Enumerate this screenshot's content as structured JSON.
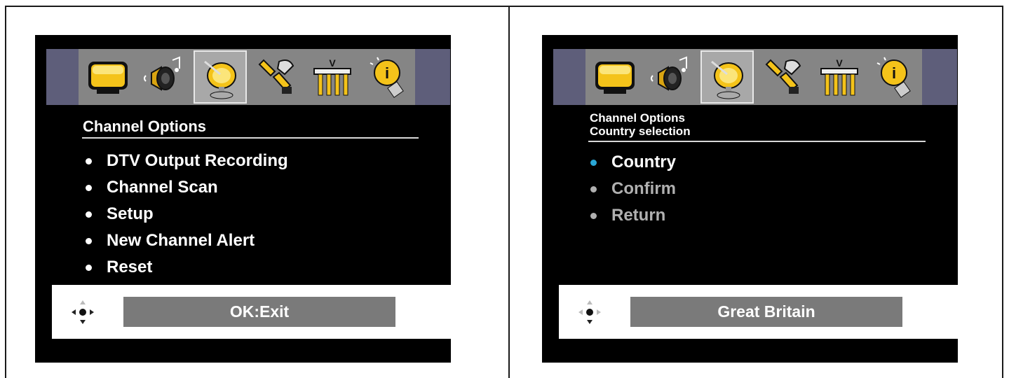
{
  "icons": [
    "picture-icon",
    "audio-icon",
    "channel-satellite-icon",
    "tools-icon",
    "parental-lock-icon",
    "info-icon"
  ],
  "left": {
    "title": "Channel Options",
    "items": [
      {
        "label": "DTV Output Recording"
      },
      {
        "label": "Channel Scan"
      },
      {
        "label": "Setup"
      },
      {
        "label": "New Channel Alert"
      },
      {
        "label": "Reset"
      }
    ],
    "status": "OK:Exit"
  },
  "right": {
    "title": "Channel Options",
    "subtitle": "Country selection",
    "items": [
      {
        "label": "Country",
        "state": "active"
      },
      {
        "label": "Confirm",
        "state": "disabled"
      },
      {
        "label": "Return",
        "state": "disabled"
      }
    ],
    "status": "Great Britain"
  },
  "colors": {
    "active_bullet": "#2aa7d6",
    "disabled_text": "#b0b0b0",
    "screen": "#000000",
    "icon_bar": "#5e5e7a",
    "status_box": "#7a7a7a"
  }
}
